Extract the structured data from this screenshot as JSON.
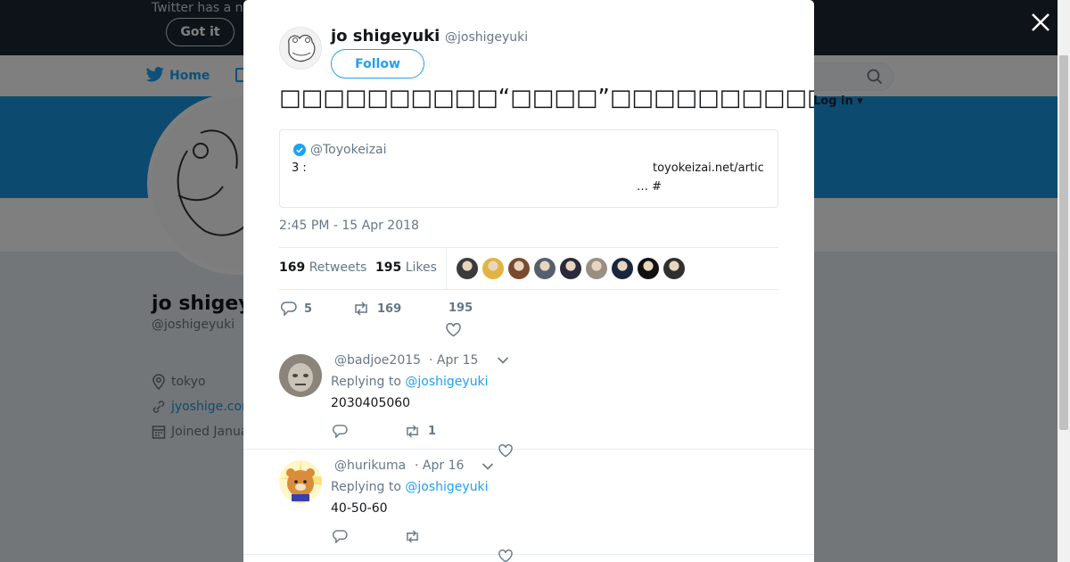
{
  "background": {
    "banner_text": "Twitter has a n",
    "got_it": "Got it",
    "nav_home": "Home",
    "login": "Log in ▾",
    "profile_name": "jo shigey",
    "profile_handle": "@joshigeyuki",
    "location": "tokyo",
    "website": "jyoshige.com",
    "joined": "Joined Janua"
  },
  "tweet": {
    "author_name": "jo shigeyuki",
    "author_handle": "@joshigeyuki",
    "follow_label": "Follow",
    "text": "□□□□□□□□□□“□□□□”□□□□□□□□□□□(□)",
    "quote": {
      "handle": "@Toyokeizai",
      "line1_a": "3 :",
      "line1_b": "toyokeizai.net/artic",
      "line2": "… #"
    },
    "timestamp": "2:45 PM - 15 Apr 2018",
    "retweets_count": "169",
    "retweets_label": "Retweets",
    "likes_count": "195",
    "likes_label": "Likes",
    "replies_action": "5",
    "retweets_action": "169",
    "likes_action": "195"
  },
  "likers": [
    "#3b3b3b",
    "#e3b341",
    "#7a4a2e",
    "#55606e",
    "#2a2a3a",
    "#9a8f85",
    "#1a2540",
    "#111111",
    "#303030"
  ],
  "replies": [
    {
      "handle": "@badjoe2015",
      "date": "· Apr 15",
      "replying_prefix": "Replying to",
      "replying_to": "@joshigeyuki",
      "body": "2030405060",
      "retweets": "1"
    },
    {
      "handle": "@hurikuma",
      "date": "· Apr 16",
      "replying_prefix": "Replying to",
      "replying_to": "@joshigeyuki",
      "body": "40-50-60",
      "retweets": ""
    }
  ]
}
